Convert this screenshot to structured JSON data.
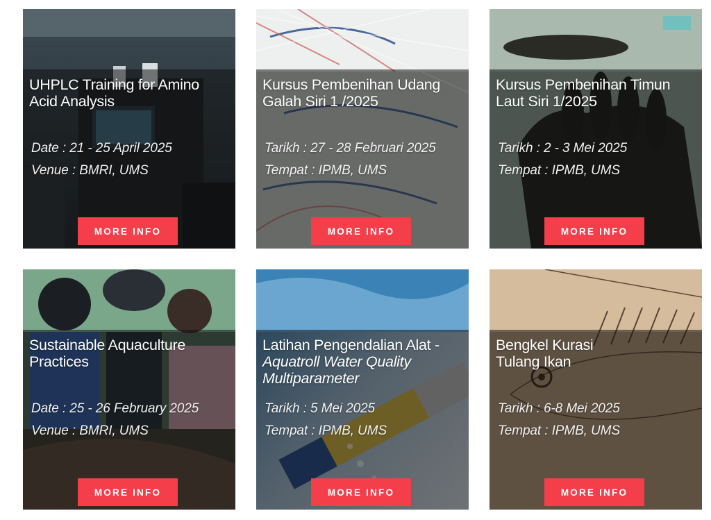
{
  "colors": {
    "button": "#f43f4b",
    "overlay": "#0f0f0f"
  },
  "cards": [
    {
      "image": "lab-instrument-photo",
      "title_lines": [
        "UHPLC Training for Amino",
        "Acid Analysis"
      ],
      "line1": "Date : 21 - 25 April 2025",
      "line2": "Venue : BMRI, UMS",
      "button": "MORE INFO"
    },
    {
      "image": "prawn-photo",
      "title_lines": [
        "Kursus Pembenihan Udang",
        "Galah Siri 1 /2025"
      ],
      "line1": "Tarikh : 27 - 28 Februari 2025",
      "line2": "Tempat : IPMB, UMS",
      "button": "MORE INFO"
    },
    {
      "image": "sea-cucumber-photo",
      "title_lines": [
        "Kursus Pembenihan Timun",
        "Laut Siri 1/2025"
      ],
      "line1": "Tarikh : 2 - 3 Mei 2025",
      "line2": "Tempat : IPMB, UMS",
      "button": "MORE INFO"
    },
    {
      "image": "aquaculture-students-photo",
      "title_lines": [
        "Sustainable Aquaculture",
        "Practices"
      ],
      "line1": "Date : 25 - 26 February 2025",
      "line2": "Venue : BMRI, UMS",
      "button": "MORE INFO"
    },
    {
      "image": "water-probe-photo",
      "title_lines": [
        "Latihan Pengendalian Alat -",
        "Aquatroll Water Quality",
        "Multiparameter"
      ],
      "line1": "Tarikh : 5  Mei 2025",
      "line2": "Tempat : IPMB, UMS",
      "button": "MORE INFO"
    },
    {
      "image": "fish-skeleton-sketch",
      "title_lines": [
        "Bengkel Kurasi",
        "Tulang Ikan"
      ],
      "line1": "Tarikh : 6-8  Mei 2025",
      "line2": "Tempat : IPMB, UMS",
      "button": "MORE INFO"
    }
  ]
}
